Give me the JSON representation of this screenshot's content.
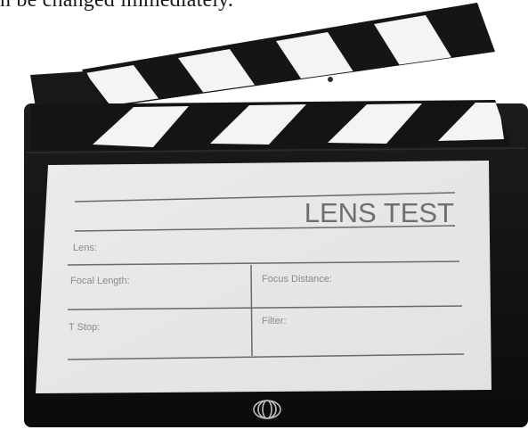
{
  "caption": "n be changed immediately.",
  "slate": {
    "title": "LENS TEST",
    "fields": {
      "lens": "Lens:",
      "focal_length": "Focal Length:",
      "focus_distance": "Focus Distance:",
      "t_stop": "T Stop:",
      "filter": "Filter:"
    },
    "logo_icon": "circle-lens-logo-icon",
    "colors": {
      "body": "#111111",
      "screen": "#e9e9e7",
      "stripe_light": "#f4f4f4"
    }
  }
}
